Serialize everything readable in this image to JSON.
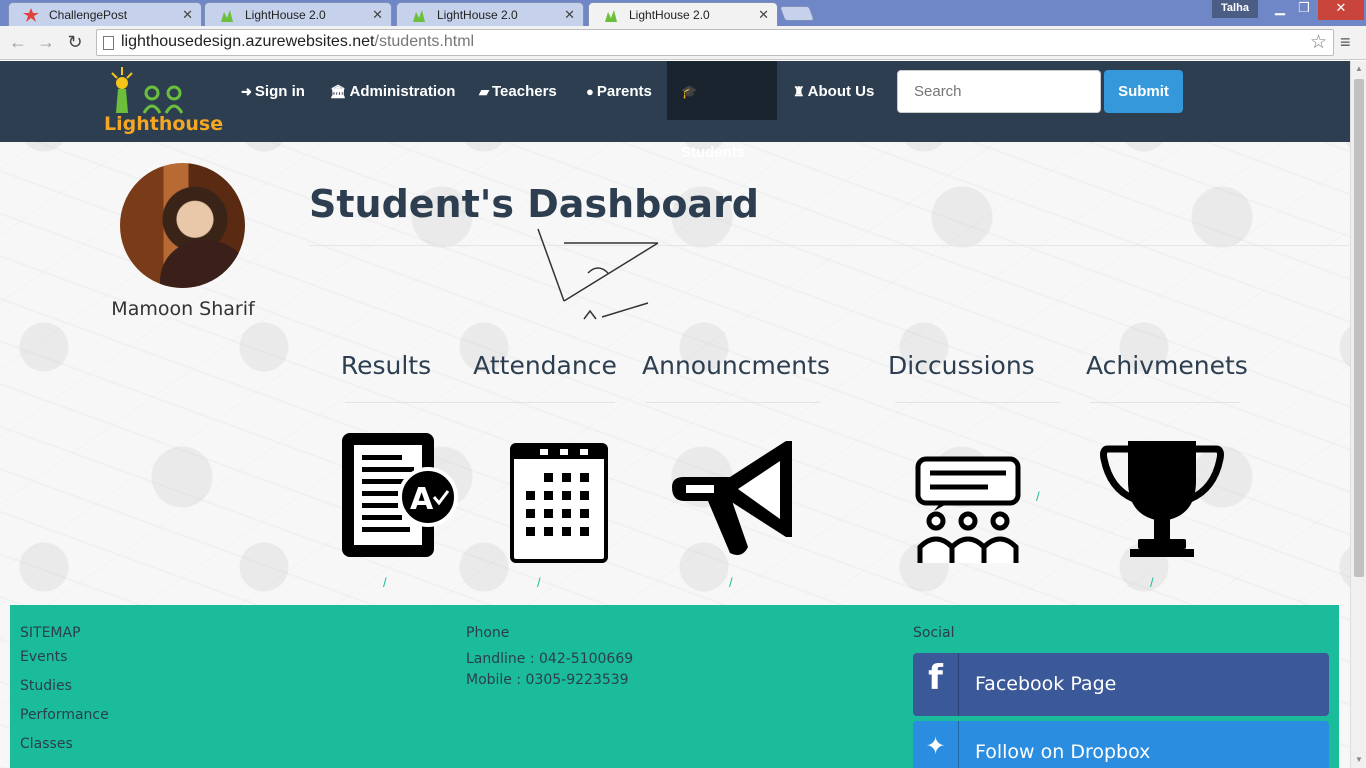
{
  "browser": {
    "tabs": [
      {
        "title": "ChallengePost",
        "active": false
      },
      {
        "title": "LightHouse 2.0",
        "active": false
      },
      {
        "title": "LightHouse 2.0",
        "active": false
      },
      {
        "title": "LightHouse 2.0",
        "active": true
      }
    ],
    "user": "Talha",
    "url_host": "lighthousedesign.azurewebsites.net",
    "url_path": "/students.html"
  },
  "navbar": {
    "logo_text": "Lighthouse",
    "items": [
      {
        "label": "Sign in",
        "icon": "sign-in-icon",
        "active": false
      },
      {
        "label": "Administration",
        "icon": "institution-icon",
        "active": false
      },
      {
        "label": "Teachers",
        "icon": "book-icon",
        "active": false
      },
      {
        "label": "Parents",
        "icon": "user-icon",
        "active": false
      },
      {
        "label": "Students",
        "icon": "graduation-cap-icon",
        "active": true
      },
      {
        "label": "About Us",
        "icon": "lighthouse-icon",
        "active": false
      }
    ],
    "search_placeholder": "Search",
    "submit_label": "Submit"
  },
  "profile": {
    "name": "Mamoon Sharif"
  },
  "dashboard": {
    "title": "Student's Dashboard",
    "modules": [
      {
        "title": "Results",
        "icon": "results-report-icon"
      },
      {
        "title": "Attendance",
        "icon": "calendar-icon"
      },
      {
        "title": "Announcments",
        "icon": "megaphone-icon"
      },
      {
        "title": "Diccussions",
        "icon": "discussion-icon"
      },
      {
        "title": "Achivmenets",
        "icon": "trophy-icon"
      }
    ],
    "link_text": "/"
  },
  "footer": {
    "sitemap_heading": "SITEMAP",
    "sitemap_links": [
      "Events",
      "Studies",
      "Performance",
      "Classes"
    ],
    "phone_heading": "Phone",
    "landline": "Landline : 042-5100669",
    "mobile": "Mobile : 0305-9223539",
    "social_heading": "Social",
    "facebook_label": "Facebook Page",
    "dropbox_label": "Follow on Dropbox",
    "colors": {
      "facebook": "#3b5998",
      "dropbox": "#2a8de0",
      "footer_bg": "#1abc9c"
    }
  },
  "colors": {
    "navbar_bg": "#2c3e50",
    "submit_bg": "#3498db",
    "brand_orange": "#f5a623"
  }
}
